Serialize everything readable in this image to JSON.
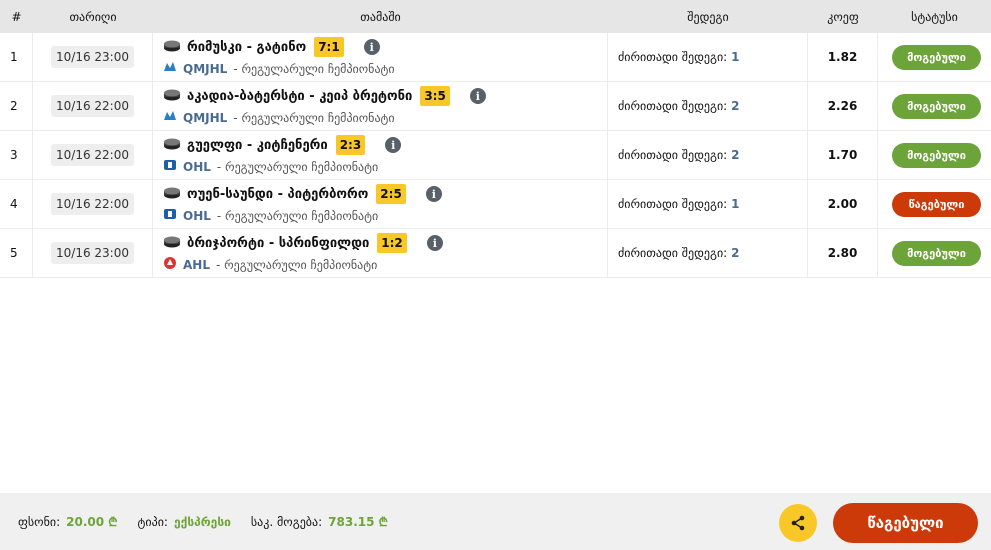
{
  "header": {
    "num": "#",
    "date": "თარიღი",
    "match": "თამაში",
    "result": "შედეგი",
    "odds": "კოეფ",
    "status": "სტატუსი"
  },
  "rows": [
    {
      "num": "1",
      "date": "10/16 23:00",
      "match": "რიმუსკი - გატინო",
      "score": "7:1",
      "league": "QMJHL",
      "league_desc": "- რეგულარული ჩემპიონატი",
      "result_label": "ძირითადი შედეგი:",
      "result_value": "1",
      "odds": "1.82",
      "status": "მოგებული",
      "status_type": "won"
    },
    {
      "num": "2",
      "date": "10/16 22:00",
      "match": "აკადია-ბატერსტი - კეიპ ბრეტონი",
      "score": "3:5",
      "league": "QMJHL",
      "league_desc": "- რეგულარული ჩემპიონატი",
      "result_label": "ძირითადი შედეგი:",
      "result_value": "2",
      "odds": "2.26",
      "status": "მოგებული",
      "status_type": "won"
    },
    {
      "num": "3",
      "date": "10/16 22:00",
      "match": "გუელფი - კიტჩენერი",
      "score": "2:3",
      "league": "OHL",
      "league_desc": "- რეგულარული ჩემპიონატი",
      "result_label": "ძირითადი შედეგი:",
      "result_value": "2",
      "odds": "1.70",
      "status": "მოგებული",
      "status_type": "won"
    },
    {
      "num": "4",
      "date": "10/16 22:00",
      "match": "ოუენ-საუნდი - პიტერბორო",
      "score": "2:5",
      "league": "OHL",
      "league_desc": "- რეგულარული ჩემპიონატი",
      "result_label": "ძირითადი შედეგი:",
      "result_value": "1",
      "odds": "2.00",
      "status": "წაგებული",
      "status_type": "lost"
    },
    {
      "num": "5",
      "date": "10/16 23:00",
      "match": "ბრიჯპორტი - სპრინფილდი",
      "score": "1:2",
      "league": "AHL",
      "league_desc": "- რეგულარული ჩემპიონატი",
      "result_label": "ძირითადი შედეგი:",
      "result_value": "2",
      "odds": "2.80",
      "status": "მოგებული",
      "status_type": "won"
    }
  ],
  "footer": {
    "stake_label": "ფსონი:",
    "stake_value": "20.00 ₾",
    "type_label": "ტიპი:",
    "type_value": "ექსპრესი",
    "potential_label": "საკ. მოგება:",
    "potential_value": "783.15 ₾",
    "share_icon": "share-icon",
    "result_button": "წაგებული"
  },
  "colors": {
    "won": "#6da43a",
    "lost": "#cd3a0a",
    "score_bg": "#f9c828",
    "league_text": "#4a6b8f"
  }
}
